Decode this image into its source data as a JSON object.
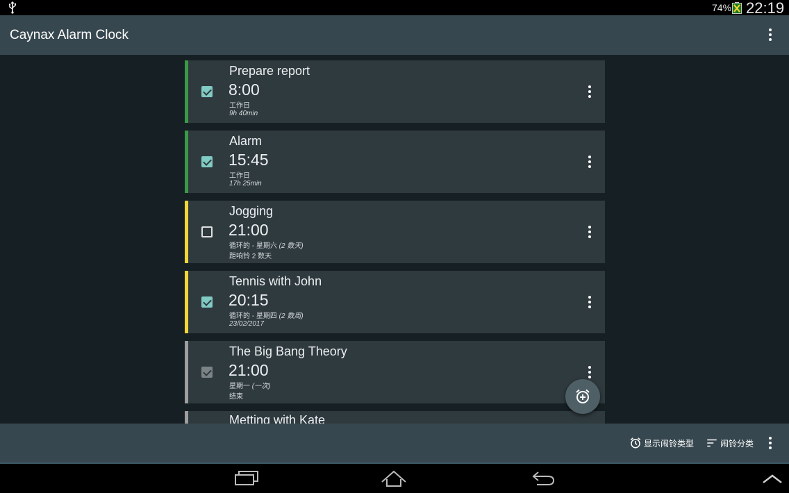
{
  "status_bar": {
    "battery_percent": "74%",
    "time": "22:19"
  },
  "app_bar": {
    "title": "Caynax Alarm Clock"
  },
  "alarms": [
    {
      "name": "Prepare report",
      "time": "8:00",
      "days": "工作日",
      "info": "9h 40min",
      "enabled": true,
      "accent": "#3a9a46"
    },
    {
      "name": "Alarm",
      "time": "15:45",
      "days": "工作日",
      "info": "17h 25min",
      "enabled": true,
      "accent": "#3a9a46"
    },
    {
      "name": "Jogging",
      "time": "21:00",
      "days_prefix": "循环的 - 星期六 ",
      "days_suffix": "(2 数天)",
      "info": "距响铃 2 数天",
      "enabled": false,
      "accent": "#f2d735"
    },
    {
      "name": "Tennis with John",
      "time": "20:15",
      "days_prefix": "循环的 - 星期四 ",
      "days_suffix": "(2 数周)",
      "info": "23/02/2017",
      "enabled": true,
      "accent": "#f2d735"
    },
    {
      "name": "The Big Bang Theory",
      "time": "21:00",
      "days_prefix": "星期一 ",
      "days_suffix": "(一次)",
      "info": "结束",
      "enabled": true,
      "disabled_look": true,
      "accent": "#9e9e9e"
    },
    {
      "name": "Metting with Kate",
      "accent": "#9e9e9e"
    }
  ],
  "bottom_bar": {
    "show_alarm_types": "显示闹铃类型",
    "sort_alarms": "闹铃分类"
  },
  "colors": {
    "app_bar": "#37474f",
    "background": "#162024",
    "card": "#2f3a3f",
    "check_accent": "#80cbc4"
  },
  "icons": [
    "usb-icon",
    "battery-icon",
    "overflow-menu-icon",
    "add-alarm-icon",
    "alarm-clock-icon",
    "sort-icon",
    "recent-apps-icon",
    "home-icon",
    "back-icon",
    "chevron-up-icon"
  ]
}
